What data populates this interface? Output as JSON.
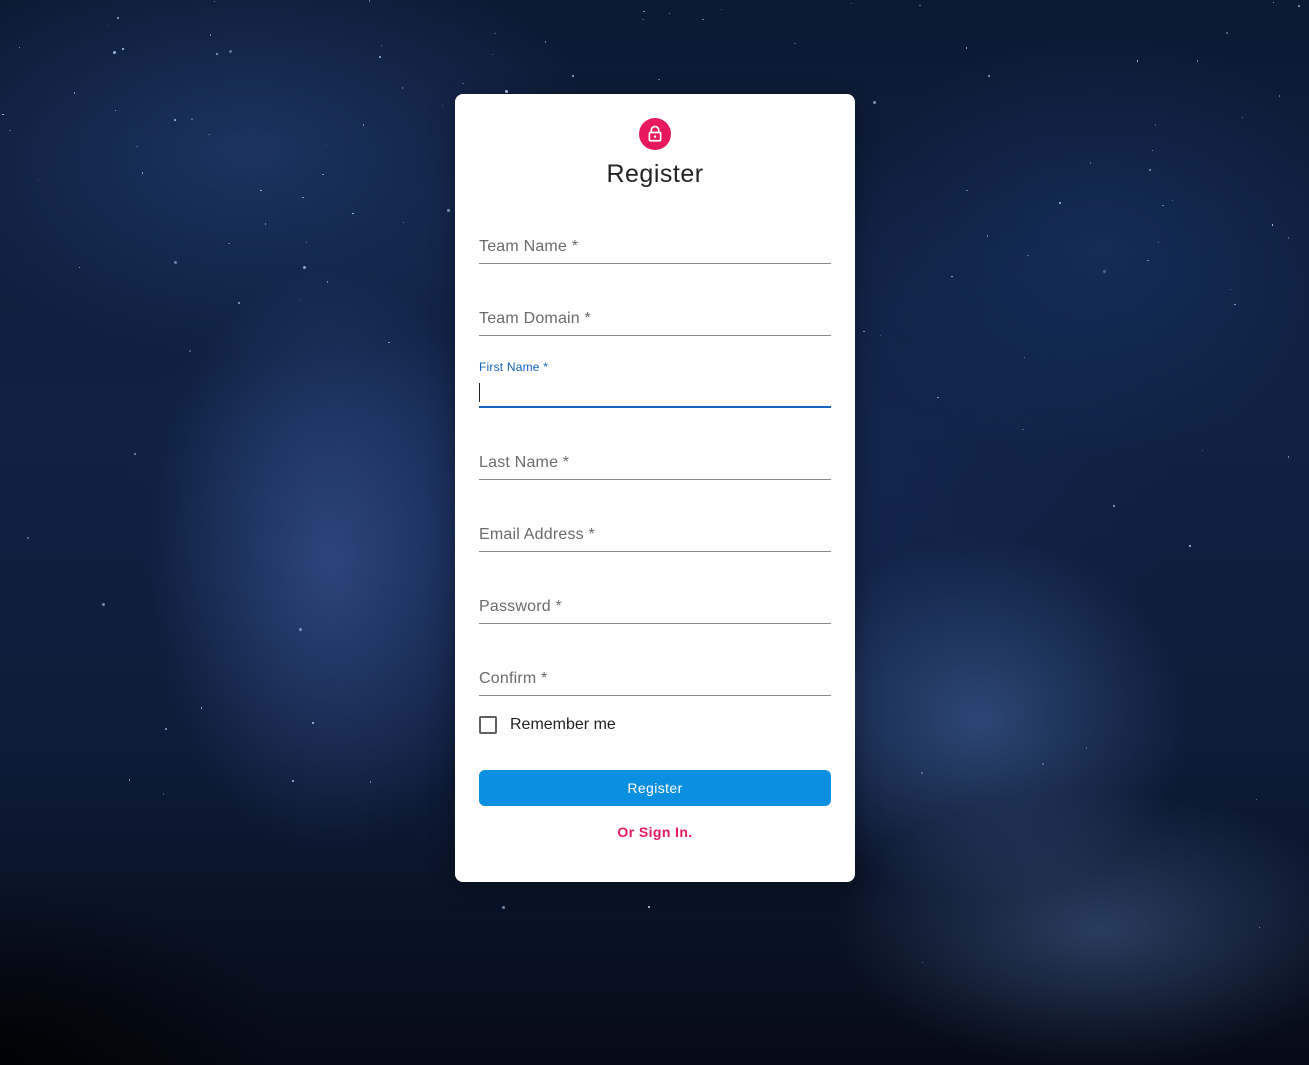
{
  "page": {
    "title": "Register"
  },
  "form": {
    "fields": [
      {
        "label": "Team Name *",
        "value": ""
      },
      {
        "label": "Team Domain *",
        "value": ""
      },
      {
        "label": "First Name *",
        "value": ""
      },
      {
        "label": "Last Name *",
        "value": ""
      },
      {
        "label": "Email Address *",
        "value": ""
      },
      {
        "label": "Password *",
        "value": ""
      },
      {
        "label": "Confirm *",
        "value": ""
      }
    ],
    "focused_field": "First Name *",
    "remember_label": "Remember me",
    "remember_checked": false,
    "submit_label": "Register",
    "signin_label": "Or Sign In."
  },
  "icons": {
    "avatar": "lock-icon"
  },
  "colors": {
    "accent": "#e8185e",
    "primary_button": "#0b8fe1",
    "focus": "#1565c0"
  }
}
